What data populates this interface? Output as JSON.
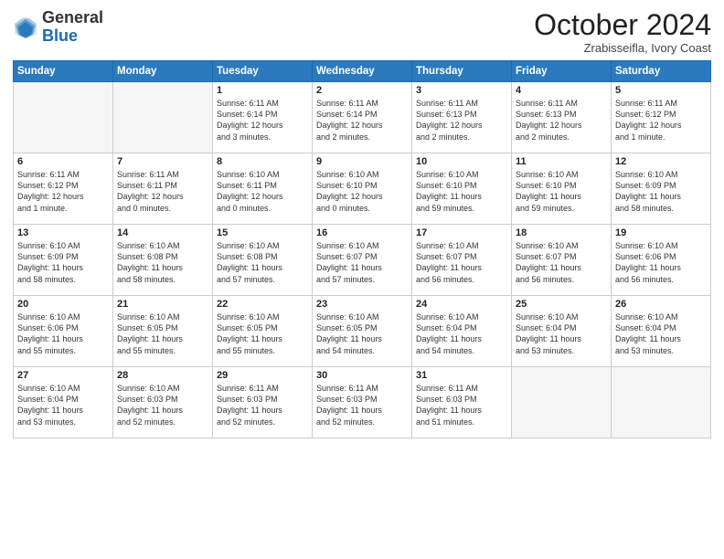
{
  "header": {
    "logo_general": "General",
    "logo_blue": "Blue",
    "title": "October 2024",
    "location": "Zrabisseifla, Ivory Coast"
  },
  "days_of_week": [
    "Sunday",
    "Monday",
    "Tuesday",
    "Wednesday",
    "Thursday",
    "Friday",
    "Saturday"
  ],
  "weeks": [
    [
      {
        "day": "",
        "content": ""
      },
      {
        "day": "",
        "content": ""
      },
      {
        "day": "1",
        "content": "Sunrise: 6:11 AM\nSunset: 6:14 PM\nDaylight: 12 hours\nand 3 minutes."
      },
      {
        "day": "2",
        "content": "Sunrise: 6:11 AM\nSunset: 6:14 PM\nDaylight: 12 hours\nand 2 minutes."
      },
      {
        "day": "3",
        "content": "Sunrise: 6:11 AM\nSunset: 6:13 PM\nDaylight: 12 hours\nand 2 minutes."
      },
      {
        "day": "4",
        "content": "Sunrise: 6:11 AM\nSunset: 6:13 PM\nDaylight: 12 hours\nand 2 minutes."
      },
      {
        "day": "5",
        "content": "Sunrise: 6:11 AM\nSunset: 6:12 PM\nDaylight: 12 hours\nand 1 minute."
      }
    ],
    [
      {
        "day": "6",
        "content": "Sunrise: 6:11 AM\nSunset: 6:12 PM\nDaylight: 12 hours\nand 1 minute."
      },
      {
        "day": "7",
        "content": "Sunrise: 6:11 AM\nSunset: 6:11 PM\nDaylight: 12 hours\nand 0 minutes."
      },
      {
        "day": "8",
        "content": "Sunrise: 6:10 AM\nSunset: 6:11 PM\nDaylight: 12 hours\nand 0 minutes."
      },
      {
        "day": "9",
        "content": "Sunrise: 6:10 AM\nSunset: 6:10 PM\nDaylight: 12 hours\nand 0 minutes."
      },
      {
        "day": "10",
        "content": "Sunrise: 6:10 AM\nSunset: 6:10 PM\nDaylight: 11 hours\nand 59 minutes."
      },
      {
        "day": "11",
        "content": "Sunrise: 6:10 AM\nSunset: 6:10 PM\nDaylight: 11 hours\nand 59 minutes."
      },
      {
        "day": "12",
        "content": "Sunrise: 6:10 AM\nSunset: 6:09 PM\nDaylight: 11 hours\nand 58 minutes."
      }
    ],
    [
      {
        "day": "13",
        "content": "Sunrise: 6:10 AM\nSunset: 6:09 PM\nDaylight: 11 hours\nand 58 minutes."
      },
      {
        "day": "14",
        "content": "Sunrise: 6:10 AM\nSunset: 6:08 PM\nDaylight: 11 hours\nand 58 minutes."
      },
      {
        "day": "15",
        "content": "Sunrise: 6:10 AM\nSunset: 6:08 PM\nDaylight: 11 hours\nand 57 minutes."
      },
      {
        "day": "16",
        "content": "Sunrise: 6:10 AM\nSunset: 6:07 PM\nDaylight: 11 hours\nand 57 minutes."
      },
      {
        "day": "17",
        "content": "Sunrise: 6:10 AM\nSunset: 6:07 PM\nDaylight: 11 hours\nand 56 minutes."
      },
      {
        "day": "18",
        "content": "Sunrise: 6:10 AM\nSunset: 6:07 PM\nDaylight: 11 hours\nand 56 minutes."
      },
      {
        "day": "19",
        "content": "Sunrise: 6:10 AM\nSunset: 6:06 PM\nDaylight: 11 hours\nand 56 minutes."
      }
    ],
    [
      {
        "day": "20",
        "content": "Sunrise: 6:10 AM\nSunset: 6:06 PM\nDaylight: 11 hours\nand 55 minutes."
      },
      {
        "day": "21",
        "content": "Sunrise: 6:10 AM\nSunset: 6:05 PM\nDaylight: 11 hours\nand 55 minutes."
      },
      {
        "day": "22",
        "content": "Sunrise: 6:10 AM\nSunset: 6:05 PM\nDaylight: 11 hours\nand 55 minutes."
      },
      {
        "day": "23",
        "content": "Sunrise: 6:10 AM\nSunset: 6:05 PM\nDaylight: 11 hours\nand 54 minutes."
      },
      {
        "day": "24",
        "content": "Sunrise: 6:10 AM\nSunset: 6:04 PM\nDaylight: 11 hours\nand 54 minutes."
      },
      {
        "day": "25",
        "content": "Sunrise: 6:10 AM\nSunset: 6:04 PM\nDaylight: 11 hours\nand 53 minutes."
      },
      {
        "day": "26",
        "content": "Sunrise: 6:10 AM\nSunset: 6:04 PM\nDaylight: 11 hours\nand 53 minutes."
      }
    ],
    [
      {
        "day": "27",
        "content": "Sunrise: 6:10 AM\nSunset: 6:04 PM\nDaylight: 11 hours\nand 53 minutes."
      },
      {
        "day": "28",
        "content": "Sunrise: 6:10 AM\nSunset: 6:03 PM\nDaylight: 11 hours\nand 52 minutes."
      },
      {
        "day": "29",
        "content": "Sunrise: 6:11 AM\nSunset: 6:03 PM\nDaylight: 11 hours\nand 52 minutes."
      },
      {
        "day": "30",
        "content": "Sunrise: 6:11 AM\nSunset: 6:03 PM\nDaylight: 11 hours\nand 52 minutes."
      },
      {
        "day": "31",
        "content": "Sunrise: 6:11 AM\nSunset: 6:03 PM\nDaylight: 11 hours\nand 51 minutes."
      },
      {
        "day": "",
        "content": ""
      },
      {
        "day": "",
        "content": ""
      }
    ]
  ]
}
